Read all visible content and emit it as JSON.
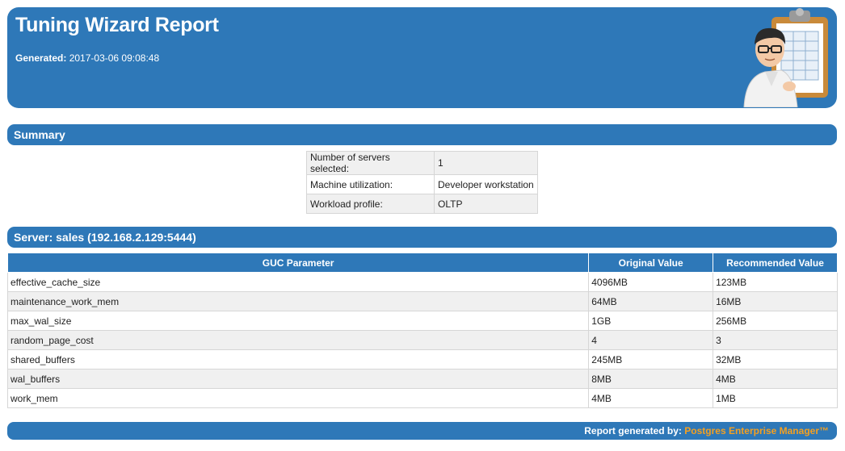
{
  "header": {
    "title": "Tuning Wizard Report",
    "generated_label": "Generated:",
    "generated_value": "2017-03-06 09:08:48",
    "illustration_icon": "man-with-clipboard-icon"
  },
  "summary": {
    "title": "Summary",
    "rows": [
      {
        "label": "Number of servers selected:",
        "value": "1"
      },
      {
        "label": "Machine utilization:",
        "value": "Developer workstation"
      },
      {
        "label": "Workload profile:",
        "value": "OLTP"
      }
    ]
  },
  "server": {
    "title": "Server: sales (192.168.2.129:5444)",
    "columns": [
      "GUC Parameter",
      "Original Value",
      "Recommended Value"
    ],
    "rows": [
      [
        "effective_cache_size",
        "4096MB",
        "123MB"
      ],
      [
        "maintenance_work_mem",
        "64MB",
        "16MB"
      ],
      [
        "max_wal_size",
        "1GB",
        "256MB"
      ],
      [
        "random_page_cost",
        "4",
        "3"
      ],
      [
        "shared_buffers",
        "245MB",
        "32MB"
      ],
      [
        "wal_buffers",
        "8MB",
        "4MB"
      ],
      [
        "work_mem",
        "4MB",
        "1MB"
      ]
    ]
  },
  "footer": {
    "label": "Report generated by:",
    "link_text": "Postgres Enterprise Manager™"
  },
  "colors": {
    "bar_blue": "#2e78b8",
    "link_orange": "#f5a020"
  }
}
